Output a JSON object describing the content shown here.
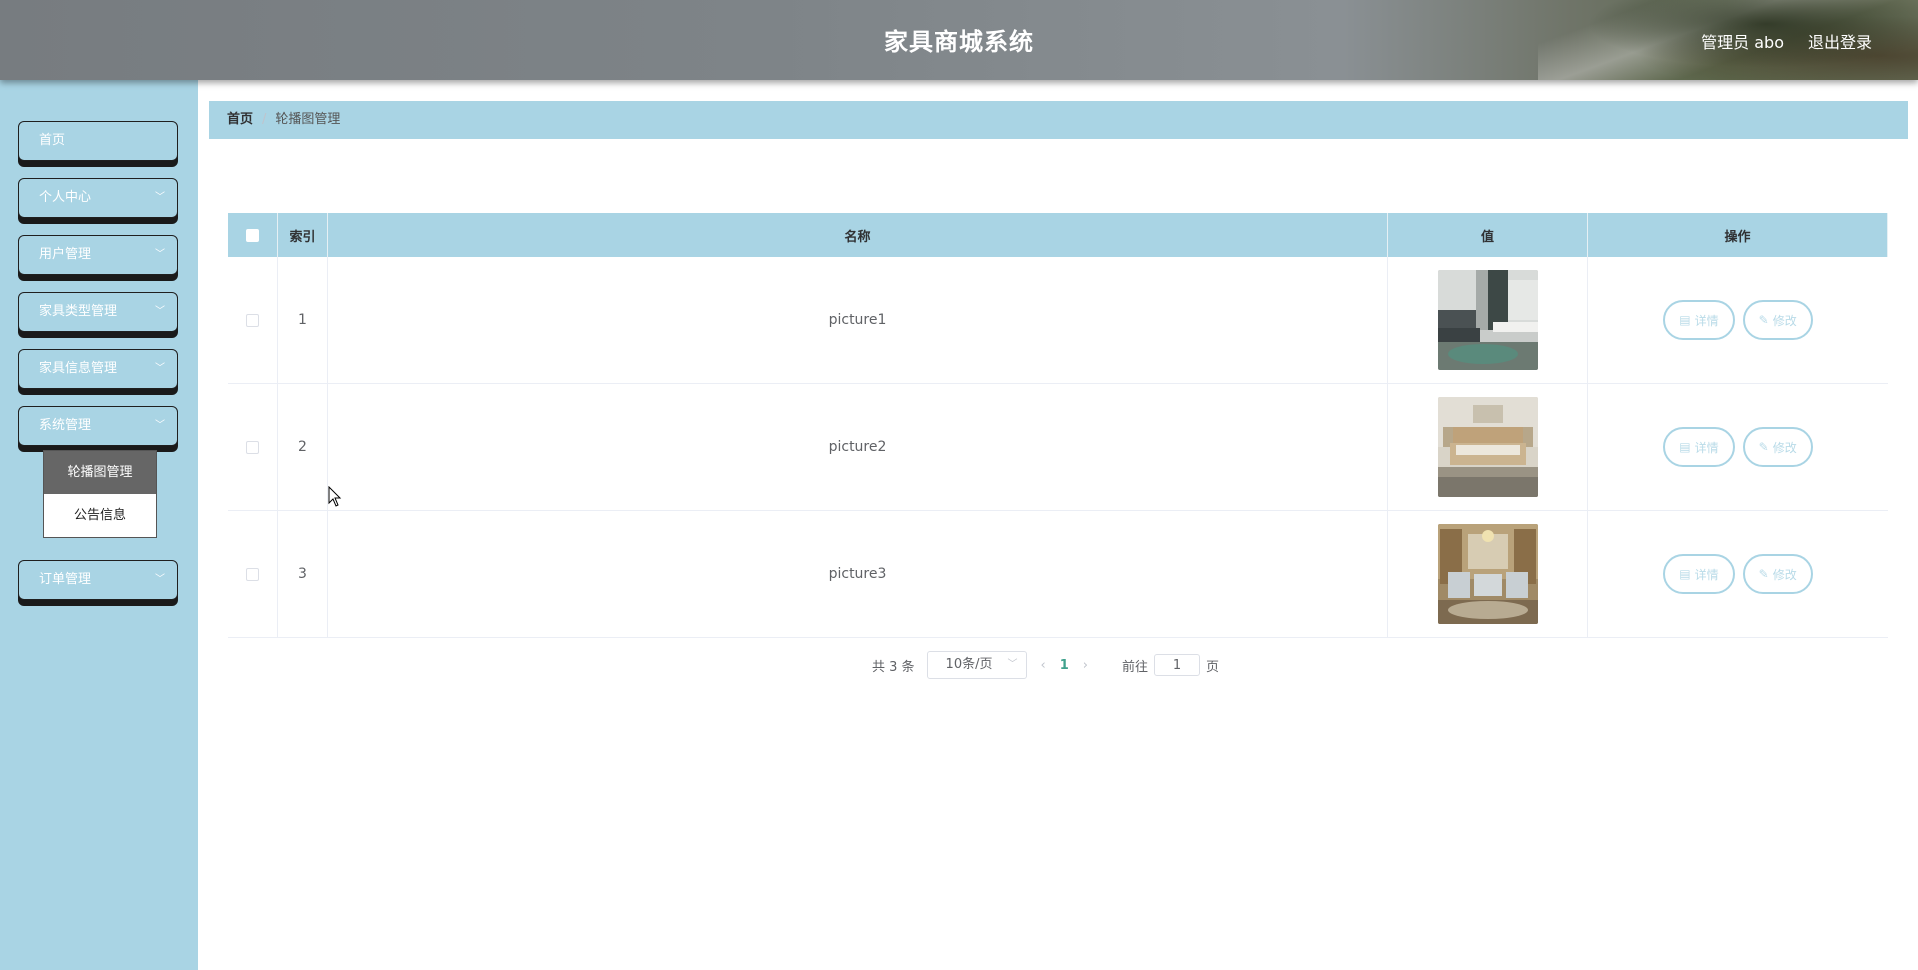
{
  "header": {
    "title": "家具商城系统",
    "user": "管理员 abo",
    "logout": "退出登录"
  },
  "sidebar": {
    "items": [
      {
        "label": "首页",
        "has_arrow": false
      },
      {
        "label": "个人中心",
        "has_arrow": true
      },
      {
        "label": "用户管理",
        "has_arrow": true
      },
      {
        "label": "家具类型管理",
        "has_arrow": true
      },
      {
        "label": "家具信息管理",
        "has_arrow": true
      },
      {
        "label": "系统管理",
        "has_arrow": true
      },
      {
        "label": "订单管理",
        "has_arrow": true
      }
    ],
    "submenu": [
      {
        "label": "轮播图管理",
        "active": true
      },
      {
        "label": "公告信息",
        "active": false
      }
    ]
  },
  "breadcrumb": {
    "home": "首页",
    "separator": "/",
    "current": "轮播图管理"
  },
  "table": {
    "columns": [
      "索引",
      "名称",
      "值",
      "操作"
    ],
    "rows": [
      {
        "index": "1",
        "name": "picture1",
        "image": "living-room-photo"
      },
      {
        "index": "2",
        "name": "picture2",
        "image": "bedroom-photo"
      },
      {
        "index": "3",
        "name": "picture3",
        "image": "classic-sofa-photo"
      }
    ],
    "detail_label": "详情",
    "edit_label": "修改"
  },
  "pagination": {
    "total": "共 3 条",
    "page_size": "10条/页",
    "current_page": "1",
    "goto_prefix": "前往",
    "goto_value": "1",
    "goto_suffix": "页"
  },
  "colors": {
    "accent": "#a9d4e4",
    "header_bg": "#7e8488",
    "active_submenu": "#666666"
  }
}
